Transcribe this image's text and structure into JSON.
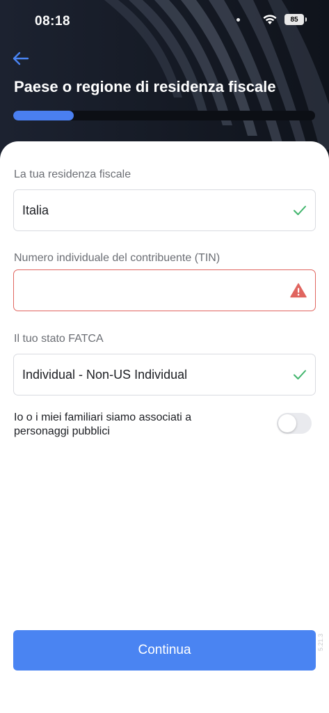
{
  "status_bar": {
    "time": "08:18",
    "battery": "85"
  },
  "header": {
    "title": "Paese o regione di residenza fiscale",
    "progress": 0.2
  },
  "form": {
    "residence": {
      "label": "La tua residenza fiscale",
      "value": "Italia",
      "status_icon": "check-icon"
    },
    "tin": {
      "label": "Numero individuale del contribuente (TIN)",
      "value": "",
      "status_icon": "warning-icon"
    },
    "fatca": {
      "label": "Il tuo stato FATCA",
      "value": "Individual - Non-US Individual",
      "status_icon": "check-icon"
    },
    "pep_toggle": {
      "label": "Io o i miei familiari siamo associati a personaggi pubblici",
      "on": false
    }
  },
  "footer": {
    "continue_label": "Continua",
    "version": "5.21.3"
  },
  "colors": {
    "accent": "#4a84f2",
    "success": "#3fb46b",
    "error": "#e0655f",
    "header_bg": "#141820"
  }
}
